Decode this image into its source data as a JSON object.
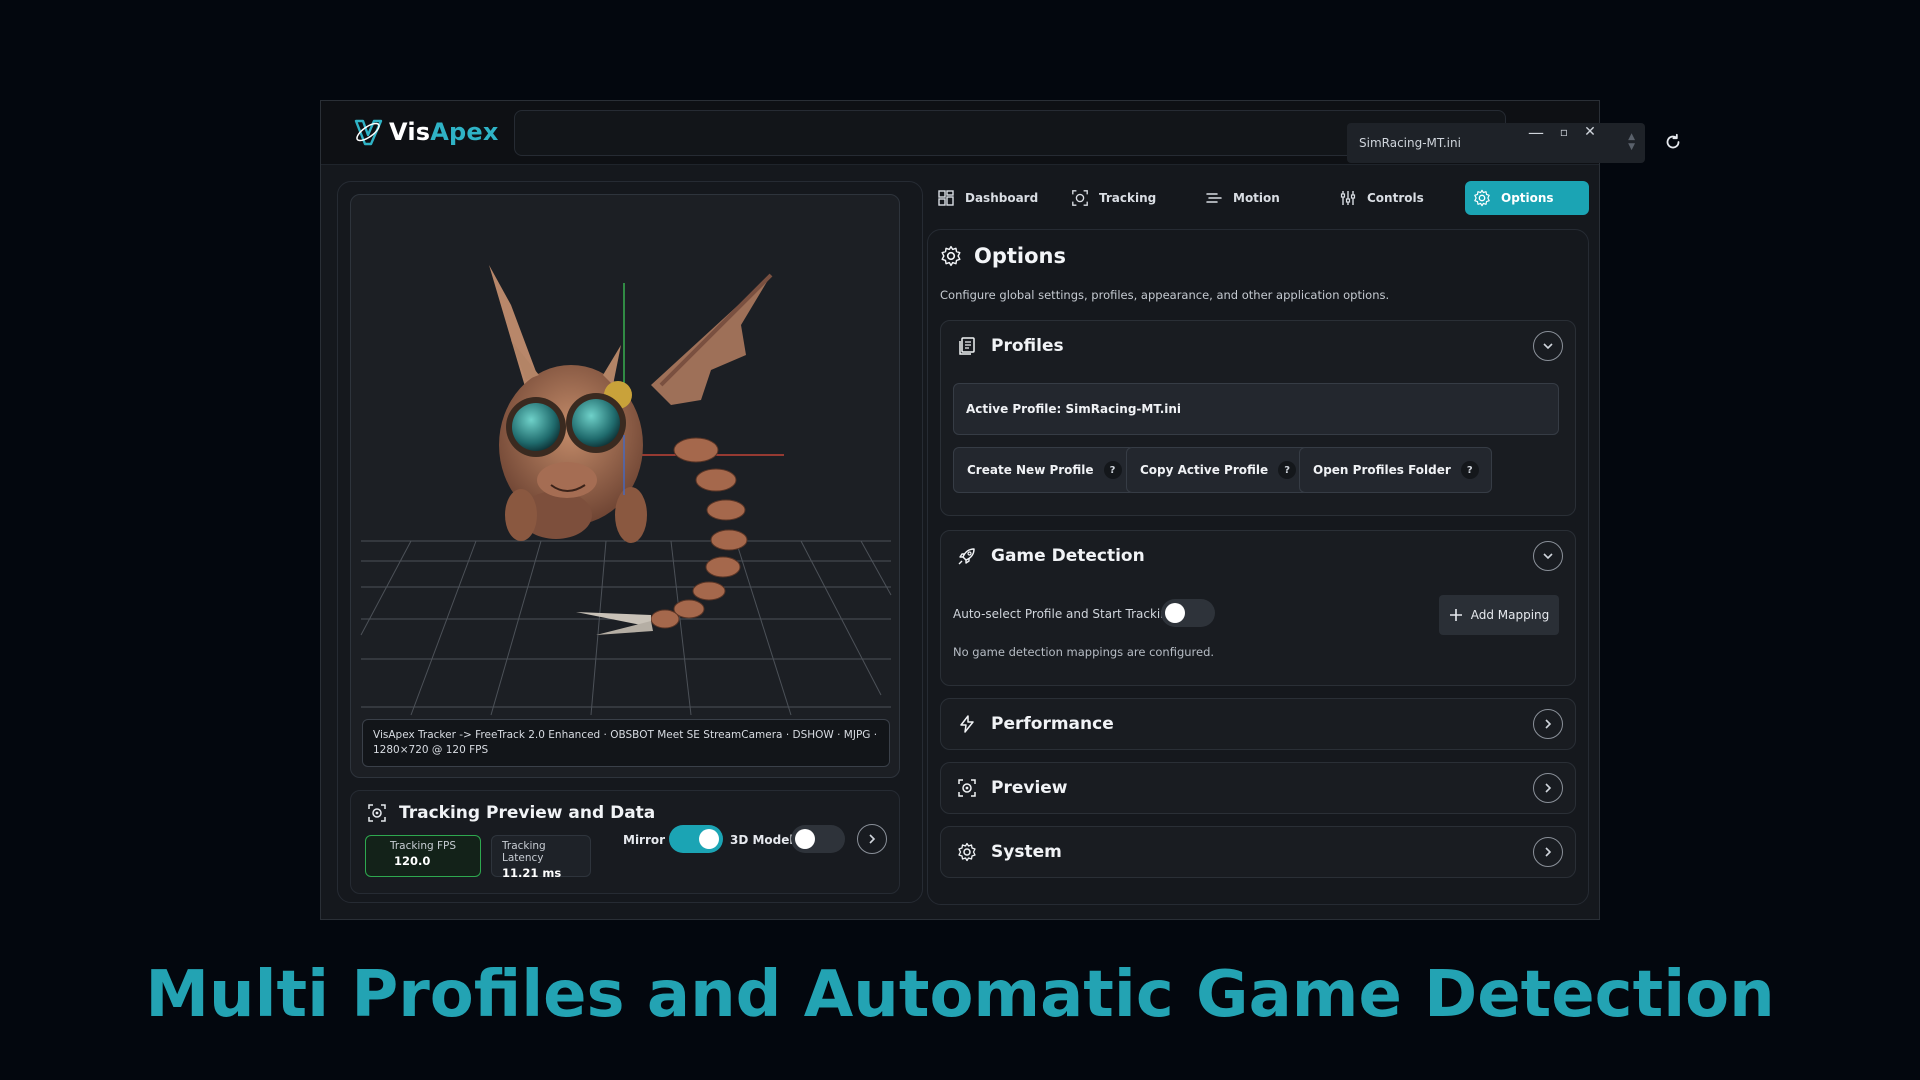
{
  "app": {
    "name_part1": "Vis",
    "name_part2": "Apex",
    "accent_color": "#1ba4b4"
  },
  "titlebar": {
    "profile_select_value": "SimRacing-MT.ini",
    "refresh_icon": "refresh-icon",
    "minimize": "—",
    "maximize": "▫",
    "close": "✕"
  },
  "viewport": {
    "tracker_info": "VisApex Tracker -> FreeTrack 2.0 Enhanced · OBSBOT Meet SE StreamCamera · DSHOW · MJPG · 1280×720 @ 120 FPS"
  },
  "tracking_preview": {
    "title": "Tracking Preview and Data",
    "fps_label": "Tracking FPS",
    "fps_value": "120.0",
    "latency_label": "Tracking Latency",
    "latency_value": "11.21 ms",
    "mirror_label": "Mirror",
    "mirror_on": true,
    "model_label": "3D Model",
    "model_on": false
  },
  "tabs": [
    {
      "label": "Dashboard",
      "icon": "dashboard-icon"
    },
    {
      "label": "Tracking",
      "icon": "tracking-icon"
    },
    {
      "label": "Motion",
      "icon": "motion-icon"
    },
    {
      "label": "Controls",
      "icon": "controls-icon"
    },
    {
      "label": "Options",
      "icon": "gear-icon",
      "active": true
    }
  ],
  "options": {
    "title": "Options",
    "description": "Configure global settings, profiles, appearance, and other application options.",
    "sections": {
      "profiles": {
        "title": "Profiles",
        "active_profile": "Active Profile: SimRacing-MT.ini",
        "buttons": [
          "Create New Profile",
          "Copy Active Profile",
          "Open Profiles Folder"
        ],
        "help": "?"
      },
      "game_detection": {
        "title": "Game Detection",
        "auto_select_label": "Auto-select Profile and Start Tracking",
        "auto_select_on": false,
        "add_mapping": "Add Mapping",
        "empty_text": "No game detection mappings are configured."
      },
      "performance": {
        "title": "Performance"
      },
      "preview": {
        "title": "Preview"
      },
      "system": {
        "title": "System"
      }
    }
  },
  "caption": "Multi Profiles and Automatic Game Detection"
}
